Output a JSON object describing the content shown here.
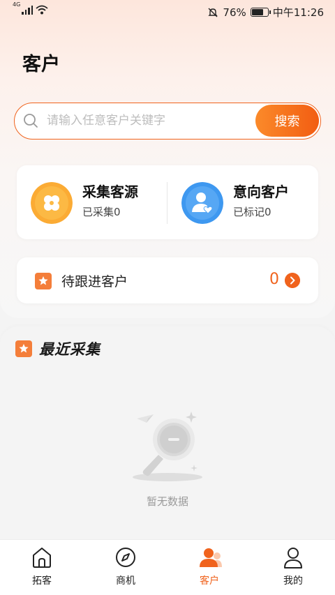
{
  "status_bar": {
    "network": "4G",
    "battery": "76%",
    "battery_level": 0.76,
    "time": "中午11:26"
  },
  "page": {
    "title": "客户"
  },
  "search": {
    "placeholder": "请输入任意客户关键字",
    "button_label": "搜索"
  },
  "stats": {
    "collect": {
      "title": "采集客源",
      "subtitle": "已采集0"
    },
    "intent": {
      "title": "意向客户",
      "subtitle": "已标记0"
    }
  },
  "follow_up": {
    "label": "待跟进客户",
    "count": "0"
  },
  "recent": {
    "title": "最近采集",
    "empty_text": "暂无数据"
  },
  "tabs": [
    {
      "label": "拓客",
      "icon": "home-icon"
    },
    {
      "label": "商机",
      "icon": "compass-icon"
    },
    {
      "label": "客户",
      "icon": "customers-icon"
    },
    {
      "label": "我的",
      "icon": "profile-icon"
    }
  ],
  "active_tab": "客户",
  "colors": {
    "accent": "#f0631d",
    "collect_icon": "#fbab34",
    "intent_icon": "#3e98f0"
  }
}
